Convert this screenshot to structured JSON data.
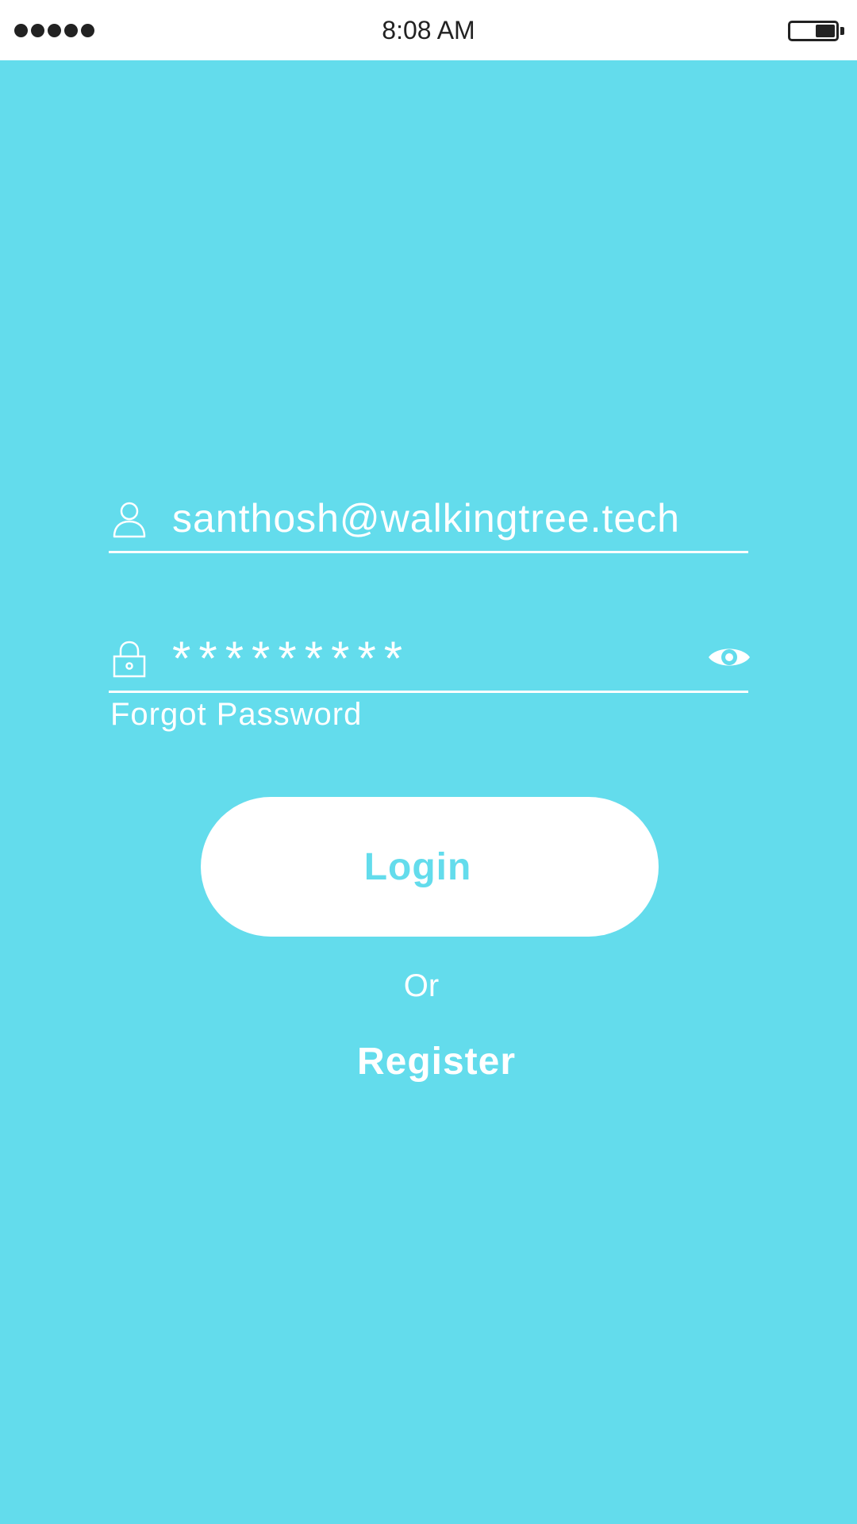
{
  "status_bar": {
    "time": "8:08 AM"
  },
  "login_form": {
    "email_value": "santhosh@walkingtree.tech",
    "password_value": "*********",
    "forgot_password_label": "Forgot Password",
    "login_label": "Login",
    "or_label": "Or",
    "register_label": "Register"
  },
  "icons": {
    "signal": "signal-dots-icon",
    "battery": "battery-icon",
    "user": "user-icon",
    "lock": "lock-icon",
    "show_password": "eye-icon"
  },
  "colors": {
    "background": "#63dcec",
    "foreground": "#ffffff",
    "status_bar": "#ffffff",
    "status_text": "#222222"
  }
}
